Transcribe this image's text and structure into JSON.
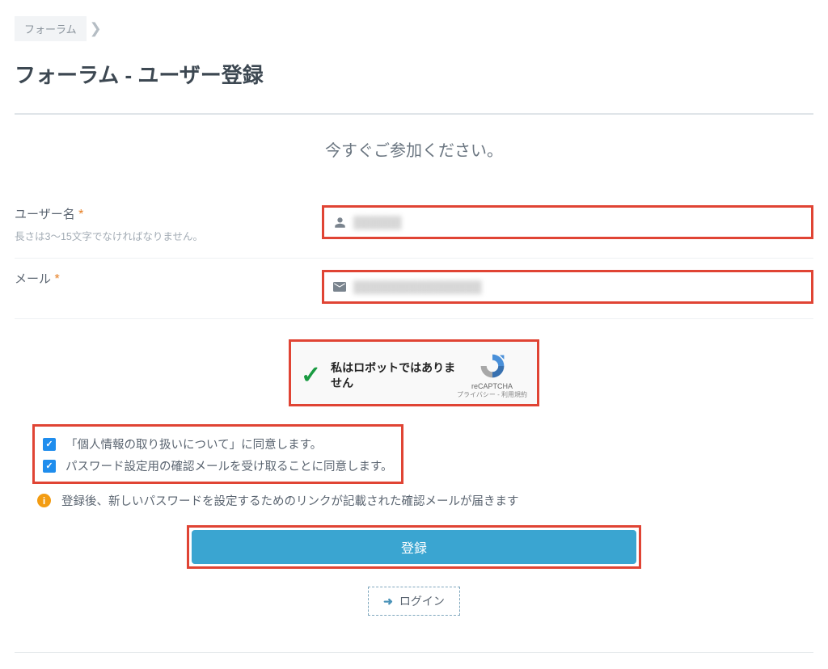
{
  "breadcrumb": {
    "item": "フォーラム"
  },
  "page_title": "フォーラム - ユーザー登録",
  "subtitle": "今すぐご参加ください。",
  "fields": {
    "username": {
      "label": "ユーザー名",
      "required_mark": "*",
      "hint": "長さは3〜15文字でなければなりません。"
    },
    "email": {
      "label": "メール",
      "required_mark": "*"
    }
  },
  "recaptcha": {
    "label": "私はロボットではありません",
    "name": "reCAPTCHA",
    "links": "プライバシー - 利用規約"
  },
  "checks": {
    "privacy": "「個人情報の取り扱いについて」に同意します。",
    "email_confirm": "パスワード設定用の確認メールを受け取ることに同意します。"
  },
  "info": "登録後、新しいパスワードを設定するためのリンクが記載された確認メールが届きます",
  "buttons": {
    "register": "登録",
    "login": "ログイン"
  },
  "highlight_color": "#e04434",
  "primary_button_color": "#3aa5d1"
}
